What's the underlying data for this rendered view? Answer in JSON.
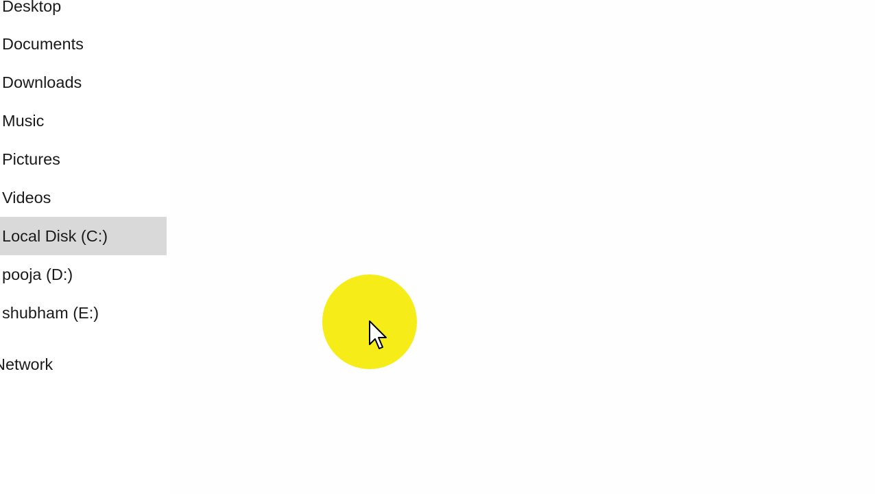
{
  "nav": {
    "items": [
      {
        "label": "Desktop",
        "icon": "desktop-icon"
      },
      {
        "label": "Documents",
        "icon": "documents-icon"
      },
      {
        "label": "Downloads",
        "icon": "downloads-icon"
      },
      {
        "label": "Music",
        "icon": "music-icon"
      },
      {
        "label": "Pictures",
        "icon": "pictures-icon"
      },
      {
        "label": "Videos",
        "icon": "videos-icon"
      },
      {
        "label": "Local Disk (C:)",
        "icon": "drive-icon",
        "selected": true
      },
      {
        "label": "pooja (D:)",
        "icon": "drive-icon"
      },
      {
        "label": "shubham (E:)",
        "icon": "drive-icon"
      },
      {
        "label": "Network",
        "icon": "network-icon"
      }
    ]
  },
  "colors": {
    "selected_background": "#d9d9d9",
    "cursor_highlight": "#f6ec17",
    "window_background": "#fefefe",
    "text": "#1a1a1a"
  },
  "cursor": {
    "icon": "mouse-pointer-icon",
    "highlight": "yellow-circle-highlight"
  }
}
